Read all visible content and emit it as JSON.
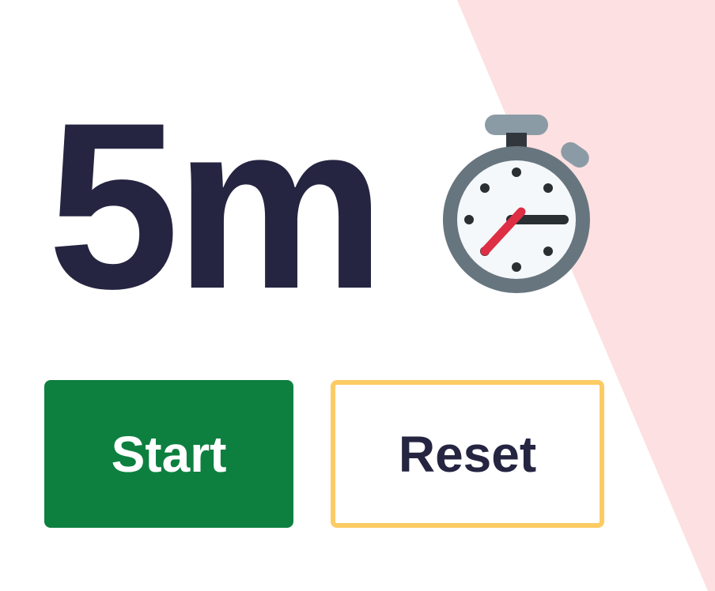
{
  "timer": {
    "value": "5m",
    "icon": "stopwatch-icon"
  },
  "controls": {
    "start_label": "Start",
    "reset_label": "Reset"
  },
  "colors": {
    "text": "#252542",
    "start_bg": "#0d8040",
    "reset_border": "#fccb64",
    "decor_bg": "#fde0e1"
  }
}
